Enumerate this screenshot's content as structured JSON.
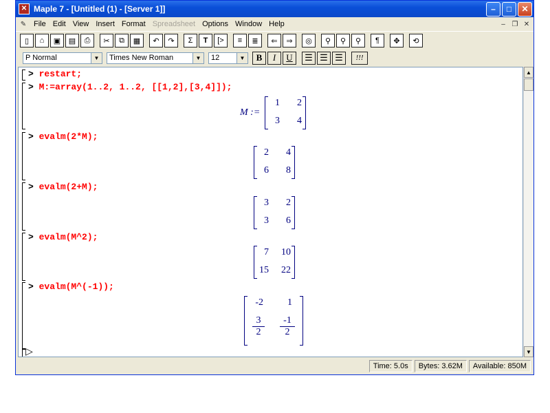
{
  "window": {
    "title": "Maple 7 - [Untitled (1) - [Server 1]]"
  },
  "menu": [
    "File",
    "Edit",
    "View",
    "Insert",
    "Format",
    "Spreadsheet",
    "Options",
    "Window",
    "Help"
  ],
  "toolbar_icons": [
    "new-icon",
    "open-icon",
    "save-all-icon",
    "save-icon",
    "print-icon",
    "cut-icon",
    "copy-icon",
    "paste-icon",
    "undo-icon",
    "redo-icon",
    "sigma-icon",
    "text-icon",
    "insert-prompt-icon",
    "indent-icon",
    "outdent-icon",
    "back-icon",
    "forward-icon",
    "stop-icon",
    "zoom-small-icon",
    "zoom-medium-icon",
    "zoom-large-icon",
    "pilcrow-icon",
    "expand-icon",
    "restart-icon"
  ],
  "format": {
    "style": "P Normal",
    "font": "Times New Roman",
    "size": "12",
    "bold": "B",
    "italic": "I",
    "underline": "U",
    "exclaim": "!!!"
  },
  "status": {
    "time": "Time:  5.0s",
    "bytes": "Bytes: 3.62M",
    "available": "Available: 850M"
  },
  "session": [
    {
      "prompt": ">",
      "input": "restart;"
    },
    {
      "prompt": ">",
      "input": "M:=array(1..2, 1..2, [[1,2],[3,4]]);",
      "lhs": "M :=",
      "matrix": [
        [
          "1",
          "2"
        ],
        [
          "3",
          "4"
        ]
      ]
    },
    {
      "prompt": ">",
      "input": "evalm(2*M);",
      "matrix": [
        [
          "2",
          "4"
        ],
        [
          "6",
          "8"
        ]
      ]
    },
    {
      "prompt": ">",
      "input": "evalm(2+M);",
      "matrix": [
        [
          "3",
          "2"
        ],
        [
          "3",
          "6"
        ]
      ]
    },
    {
      "prompt": ">",
      "input": "evalm(M^2);",
      "matrix": [
        [
          "7",
          "10"
        ],
        [
          "15",
          "22"
        ]
      ]
    },
    {
      "prompt": ">",
      "input": "evalm(M^(-1));",
      "matrix": [
        [
          "-2",
          "1"
        ],
        [
          {
            "num": "3",
            "den": "2"
          },
          {
            "num": "-1",
            "den": "2"
          }
        ]
      ]
    }
  ]
}
